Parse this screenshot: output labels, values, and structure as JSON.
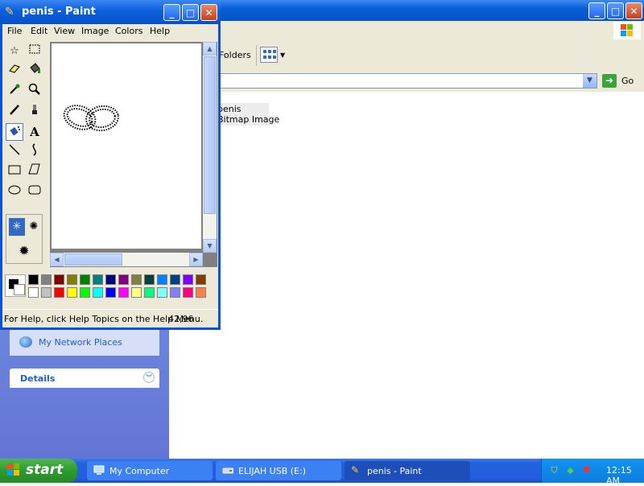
{
  "explorer": {
    "window_controls": {
      "minimize": "_",
      "maximize": "□",
      "close": "✕"
    },
    "toolbar": {
      "folders_label": "Folders",
      "views_icon": "views-icon"
    },
    "address": {
      "go_label": "Go"
    },
    "file": {
      "name": "penis",
      "type": "Bitmap Image"
    },
    "left_panel": {
      "network_places": "My Network Places",
      "details": "Details"
    }
  },
  "paint": {
    "title": "penis - Paint",
    "window_controls": {
      "minimize": "_",
      "maximize": "□",
      "close": "✕"
    },
    "menu": [
      "File",
      "Edit",
      "View",
      "Image",
      "Colors",
      "Help"
    ],
    "tools": [
      "free-form-select",
      "rectangle-select",
      "eraser",
      "fill-with-color",
      "pick-color",
      "magnifier",
      "pencil",
      "brush",
      "airbrush",
      "text",
      "line",
      "curve",
      "rectangle",
      "polygon",
      "ellipse",
      "rounded-rectangle"
    ],
    "selected_tool": "airbrush",
    "palette": {
      "foreground": "#000000",
      "background": "#ffffff",
      "row1": [
        "#000000",
        "#808080",
        "#800000",
        "#808000",
        "#008000",
        "#008080",
        "#000080",
        "#800080",
        "#808040",
        "#004040",
        "#0080ff",
        "#004080",
        "#8000ff",
        "#804000"
      ],
      "row2": [
        "#ffffff",
        "#c0c0c0",
        "#ff0000",
        "#ffff00",
        "#00ff00",
        "#00ffff",
        "#0000ff",
        "#ff00ff",
        "#ffff80",
        "#00ff80",
        "#80ffff",
        "#8080ff",
        "#ff0080",
        "#ff8040"
      ]
    },
    "status": "For Help, click Help Topics on the Help Menu.",
    "coords": "42,96"
  },
  "taskbar": {
    "start_label": "start",
    "tasks": [
      {
        "label": "My Computer",
        "icon": "computer-icon"
      },
      {
        "label": "ELIJAH USB (E:)",
        "icon": "usb-drive-icon"
      },
      {
        "label": "penis - Paint",
        "icon": "paint-icon"
      }
    ],
    "clock": "12:15 AM"
  }
}
